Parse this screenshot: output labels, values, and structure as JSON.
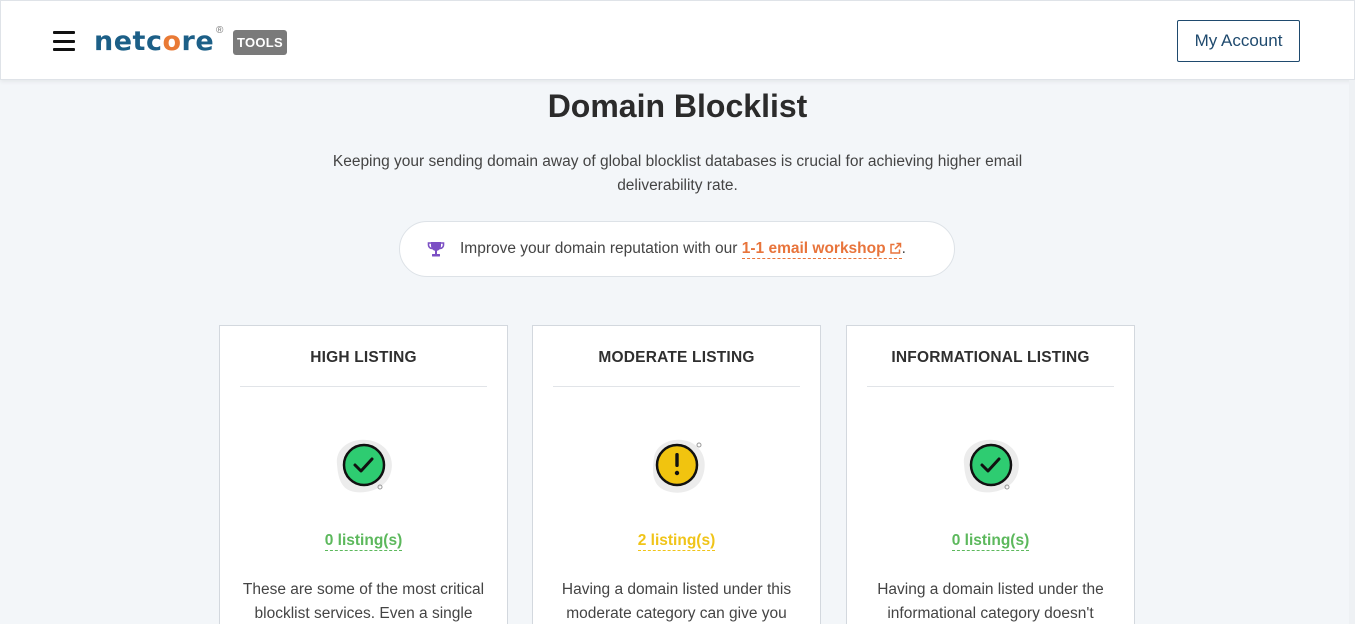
{
  "header": {
    "logo_text_start": "netc",
    "logo_text_o": "o",
    "logo_text_end": "re",
    "logo_reg": "®",
    "tools_badge": "TOOLS",
    "account_button": "My Account"
  },
  "page": {
    "title": "Domain Blocklist",
    "subtitle": "Keeping your sending domain away of global blocklist databases is crucial for achieving higher email deliverability rate."
  },
  "promo": {
    "icon": "trophy-icon",
    "text": "Improve your domain reputation with our ",
    "link_text": "1-1 email workshop",
    "link_icon": "external-link-icon",
    "suffix": "."
  },
  "cards": [
    {
      "title": "HIGH LISTING",
      "status_icon": "check-circle-icon",
      "listing": "0 listing(s)",
      "listing_color": "#5cb85c",
      "description": "These are some of the most critical blocklist services. Even a single"
    },
    {
      "title": "MODERATE LISTING",
      "status_icon": "warning-circle-icon",
      "listing": "2 listing(s)",
      "listing_color": "#f0c419",
      "description": "Having a domain listed under this moderate category can give you"
    },
    {
      "title": "INFORMATIONAL LISTING",
      "status_icon": "check-circle-icon",
      "listing": "0 listing(s)",
      "listing_color": "#5cb85c",
      "description": "Having a domain listed under the informational category doesn't"
    }
  ],
  "colors": {
    "brand_blue": "#1c5f87",
    "brand_orange": "#e97a35",
    "link_orange": "#e8743b",
    "success_green": "#2ecc71",
    "warning_yellow": "#f1c40f",
    "trophy_purple": "#7b4fc4"
  }
}
